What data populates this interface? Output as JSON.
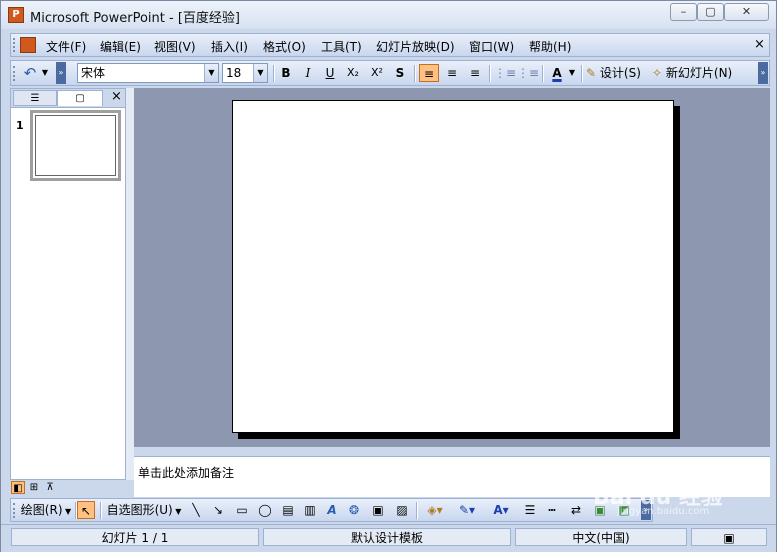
{
  "window": {
    "title": "Microsoft PowerPoint - [百度经验]",
    "app_icon_letter": "P",
    "controls": {
      "minimize": "–",
      "maximize": "▢",
      "close": "✕"
    }
  },
  "menu": {
    "items": [
      "文件(F)",
      "编辑(E)",
      "视图(V)",
      "插入(I)",
      "格式(O)",
      "工具(T)",
      "幻灯片放映(D)",
      "窗口(W)",
      "帮助(H)"
    ],
    "close": "×"
  },
  "format_toolbar": {
    "undo": "↶",
    "font_name": "宋体",
    "font_size": "18",
    "bold": "B",
    "italic": "I",
    "underline": "U",
    "subscript": "X₂",
    "superscript": "X²",
    "shadow": "S",
    "align_left": "≡",
    "align_center": "≡",
    "align_right": "≡",
    "numbering": "⋮≡",
    "bullets": "⋮≡",
    "font_color": "A",
    "design_label": "设计(S)",
    "new_slide_label": "新幻灯片(N)"
  },
  "panel": {
    "close": "×",
    "slide_number": "1"
  },
  "notes": {
    "placeholder": "单击此处添加备注"
  },
  "draw_toolbar": {
    "draw_label": "绘图(R)",
    "autoshapes_label": "自选图形(U)"
  },
  "status": {
    "slide": "幻灯片 1 / 1",
    "template": "默认设计模板",
    "language": "中文(中国)"
  },
  "watermark": {
    "brand": "Bai du 经验",
    "sub": "jingyan.baidu.com"
  }
}
